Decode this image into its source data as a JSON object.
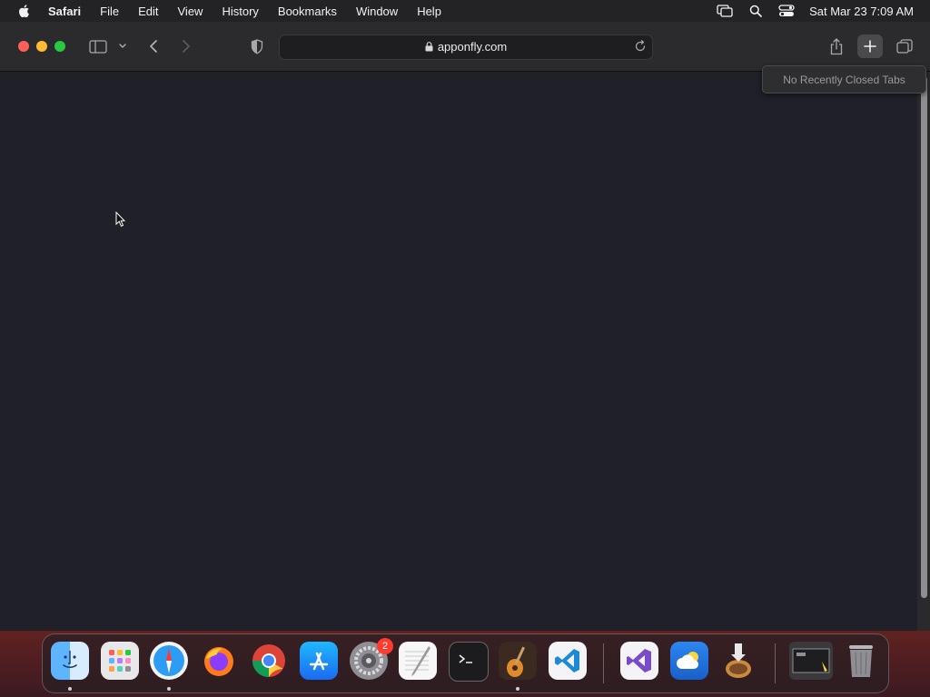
{
  "menubar": {
    "app_name": "Safari",
    "items": [
      "File",
      "Edit",
      "View",
      "History",
      "Bookmarks",
      "Window",
      "Help"
    ],
    "clock": "Sat Mar 23  7:09 AM"
  },
  "toolbar": {
    "url": "apponfly.com"
  },
  "tooltip": {
    "text": "No Recently Closed Tabs"
  },
  "dock": {
    "apps": [
      "Finder",
      "Launchpad",
      "Safari",
      "Firefox",
      "Chrome",
      "App Store",
      "System Preferences",
      "TextEdit",
      "Terminal",
      "GarageBand",
      "Visual Studio Code",
      "Visual Studio",
      "Weather",
      "Installer",
      "Screenshot",
      "Trash"
    ],
    "settings_badge": "2"
  },
  "colors": {
    "content_bg": "#1f2028",
    "close": "#ff5f57",
    "minimize": "#febc2e",
    "maximize": "#28c840"
  }
}
